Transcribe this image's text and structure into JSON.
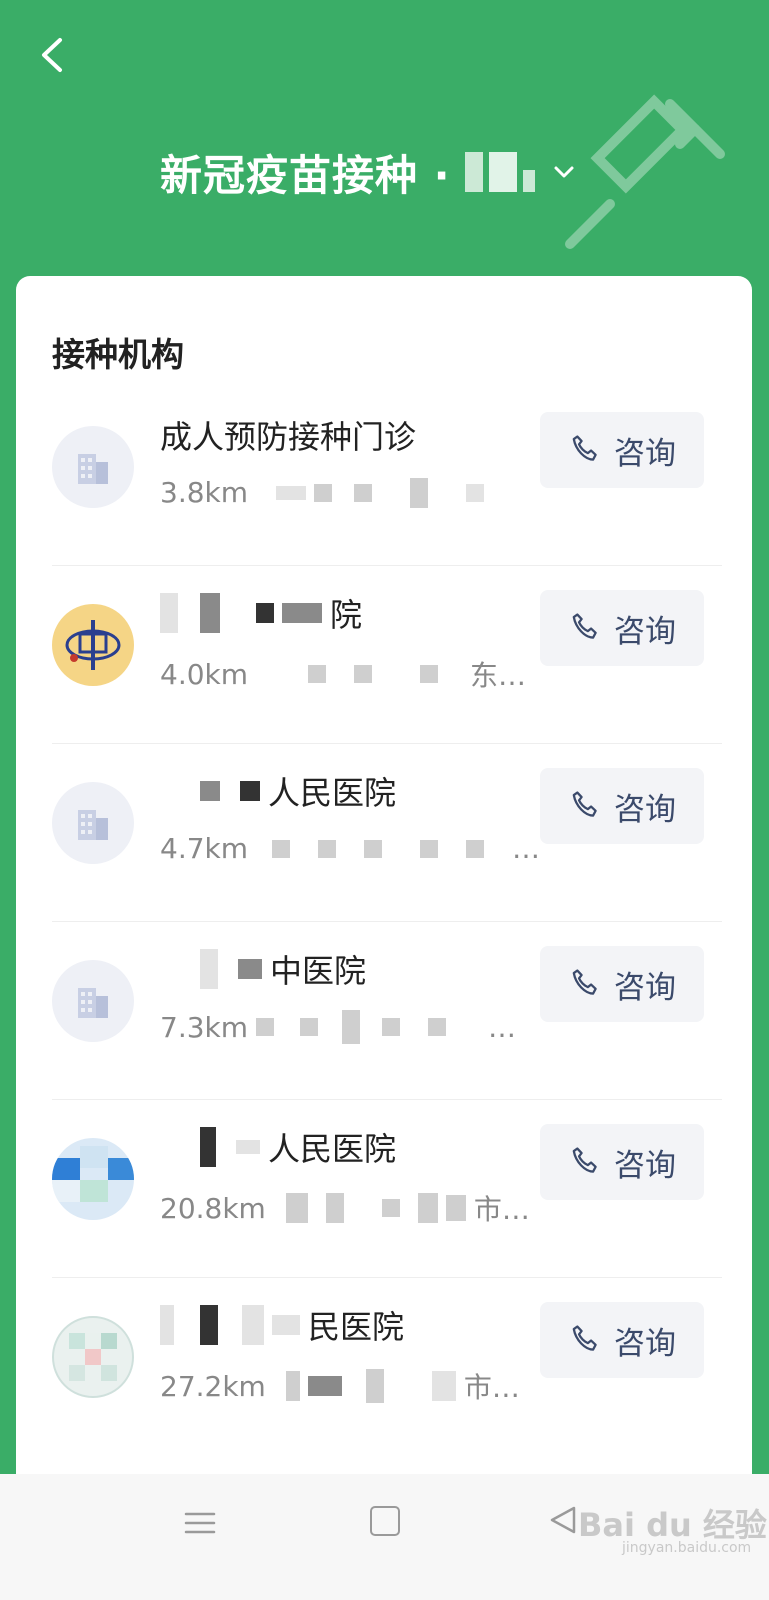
{
  "header": {
    "back_icon": "chevron-left-icon",
    "title": "新冠疫苗接种 ·",
    "dropdown_icon": "chevron-down-icon",
    "decoration_icon": "syringe-icon"
  },
  "section": {
    "title": "接种机构"
  },
  "institutions": [
    {
      "name": "成人预防接种门诊",
      "distance": "3.8km",
      "address_suffix": "",
      "consult_label": "咨询",
      "logo": "building-icon"
    },
    {
      "name_suffix": "院",
      "distance": "4.0km",
      "address_suffix": "东…",
      "consult_label": "咨询",
      "logo": "hospital-logo"
    },
    {
      "name_suffix": "人民医院",
      "distance": "4.7km",
      "address_suffix": "…",
      "consult_label": "咨询",
      "logo": "building-icon"
    },
    {
      "name_suffix": "中医院",
      "distance": "7.3km",
      "address_suffix": "…",
      "consult_label": "咨询",
      "logo": "building-icon"
    },
    {
      "name_suffix": "人民医院",
      "distance": "20.8km",
      "address_suffix": "市…",
      "consult_label": "咨询",
      "logo": "hospital-logo"
    },
    {
      "name_suffix": "民医院",
      "distance": "27.2km",
      "address_suffix": "市…",
      "consult_label": "咨询",
      "logo": "hospital-logo"
    }
  ],
  "icons": {
    "consult": "phone-icon"
  },
  "navbar": {
    "menu_icon": "menu-icon",
    "home_icon": "square-home-icon",
    "back_icon": "triangle-back-icon",
    "watermark": "Bai du 经验",
    "watermark_sub": "jingyan.baidu.com"
  },
  "colors": {
    "primary_green": "#3aad67",
    "consult_text": "#3b4a6b",
    "card_bg": "#ffffff"
  }
}
